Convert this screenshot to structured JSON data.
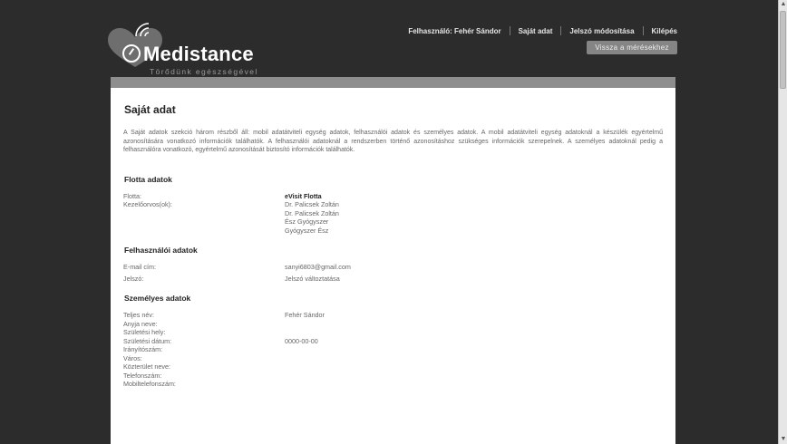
{
  "brand": {
    "name": "Medistance",
    "tagline": "Törődünk egészségével"
  },
  "nav": {
    "user": "Felhasználó: Fehér Sándor",
    "own_data": "Saját adat",
    "change_password": "Jelszó módosítása",
    "logout": "Kilépés",
    "back_button": "Vissza a mérésekhez"
  },
  "page": {
    "title": "Saját adat",
    "intro": "A Saját adatok szekció három részből áll: mobil adatátviteli egység adatok, felhasználói adatok és személyes adatok. A mobil adatátviteli egység adatoknál a készülék egyértelmű azonosítására vonatkozó információk találhatók. A felhasználói adatoknál a rendszerben történő azonosításhoz szükséges információk szerepelnek. A személyes adatoknál pedig a felhasználóra vonatkozó, egyértelmű azonosítását biztosító információk találhatók."
  },
  "fleet": {
    "title": "Flotta adatok",
    "fleet_label": "Flotta:",
    "fleet_value": "eVisit Flotta",
    "doctors_label": "Kezelőorvos(ok):",
    "doctors": [
      "Dr. Palicsek Zoltán",
      "Dr. Palicsek Zoltán",
      "Ész Gyógyszer",
      "Gyógyszer Ész"
    ]
  },
  "user": {
    "title": "Felhasználói adatok",
    "email_label": "E-mail cím:",
    "email_value": "sanyi6803@gmail.com",
    "password_label": "Jelszó:",
    "password_value": "Jelszó változtatása"
  },
  "personal": {
    "title": "Személyes adatok",
    "rows": [
      {
        "label": "Teljes név:",
        "value": "Fehér Sándor"
      },
      {
        "label": "Anyja neve:",
        "value": ""
      },
      {
        "label": "Születési hely:",
        "value": ""
      },
      {
        "label": "Születési dátum:",
        "value": "0000-00-00"
      },
      {
        "label": "Irányítószám:",
        "value": ""
      },
      {
        "label": "Város:",
        "value": ""
      },
      {
        "label": "Közterület neve:",
        "value": ""
      },
      {
        "label": "Telefonszám:",
        "value": ""
      },
      {
        "label": "Mobiltelefonszám:",
        "value": ""
      }
    ]
  },
  "colors": {
    "background": "#2c2c2c",
    "panel": "#ffffff",
    "band": "#8e8e8e",
    "button": "#858585"
  },
  "icons": [
    "medistance-logo-icon",
    "scroll-up-icon",
    "scroll-down-icon"
  ]
}
